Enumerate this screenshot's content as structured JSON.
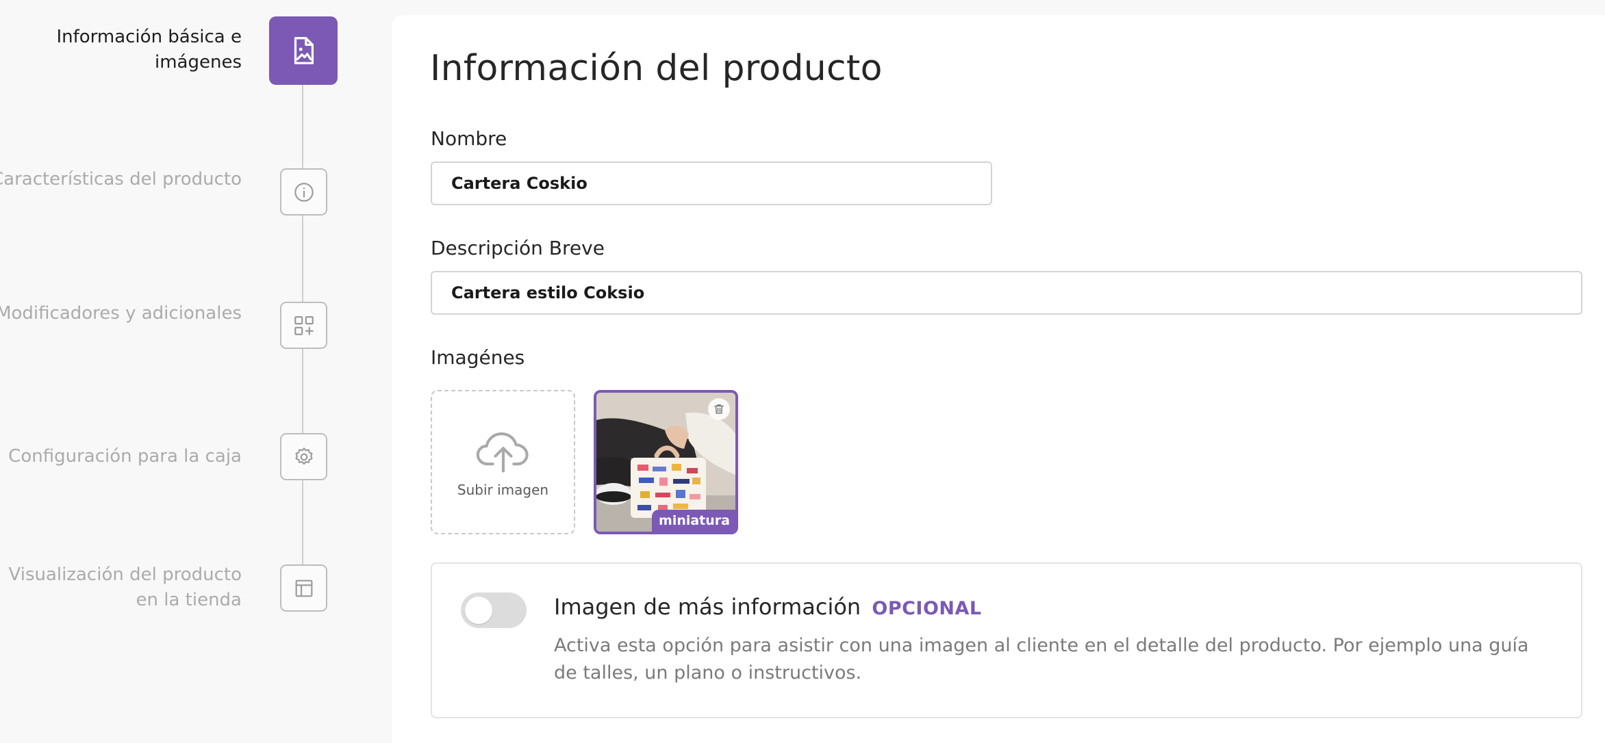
{
  "colors": {
    "accent": "#7b59b5",
    "muted_text": "#ababab",
    "border": "#d4d4d4"
  },
  "steps": [
    {
      "label": "Información básica e imágenes",
      "icon": "image-file-icon",
      "active": true
    },
    {
      "label": "Características del producto",
      "icon": "info-icon",
      "active": false
    },
    {
      "label": "Modificadores y adicionales",
      "icon": "grid-add-icon",
      "active": false
    },
    {
      "label": "Configuración para la caja",
      "icon": "gear-icon",
      "active": false
    },
    {
      "label": "Visualización del producto en la tienda",
      "icon": "layout-icon",
      "active": false
    }
  ],
  "form": {
    "title": "Información del producto",
    "name_label": "Nombre",
    "name_value": "Cartera Coskio",
    "description_label": "Descripción Breve",
    "description_value": "Cartera estilo Coksio",
    "images_label": "Imagénes",
    "upload_label": "Subir imagen",
    "thumbnail_badge": "miniatura"
  },
  "extra_info": {
    "toggle_on": false,
    "title": "Imagen de más información",
    "optional_tag": "OPCIONAL",
    "description": "Activa esta opción para asistir con una imagen al cliente en el detalle del producto. Por ejemplo una guía de talles, un plano o instructivos."
  }
}
